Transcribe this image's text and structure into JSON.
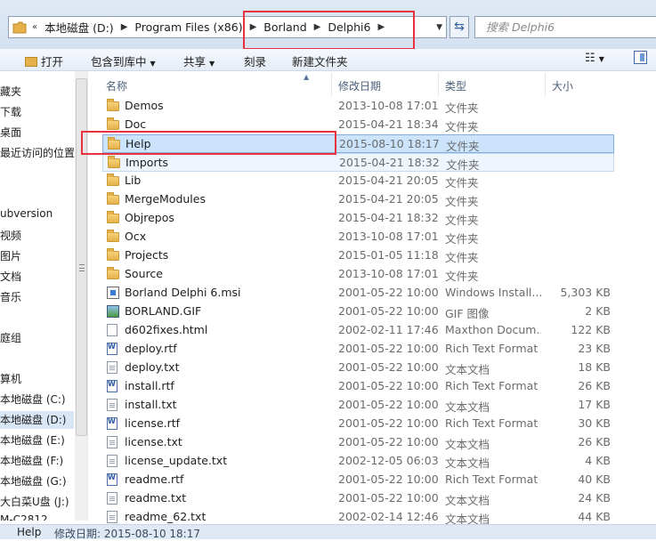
{
  "address": {
    "crumbs": [
      "本地磁盘 (D:)",
      "Program Files (x86)",
      "Borland",
      "Delphi6"
    ],
    "search_placeholder": "搜索 Delphi6"
  },
  "toolbar": {
    "open": "打开",
    "include_in_library": "包含到库中",
    "share": "共享",
    "burn": "刻录",
    "new_folder": "新建文件夹"
  },
  "nav": {
    "items": [
      "藏夹",
      "下载",
      "桌面",
      "最近访问的位置",
      "ubversion",
      "视频",
      "图片",
      "文档",
      "音乐",
      "庭组",
      "算机",
      "本地磁盘 (C:)",
      "本地磁盘 (D:)",
      "本地磁盘 (E:)",
      "本地磁盘 (F:)",
      "本地磁盘 (G:)",
      "大白菜U盘 (J:)",
      "M-C2812"
    ],
    "selected": "本地磁盘 (D:)"
  },
  "columns": {
    "name": "名称",
    "modified": "修改日期",
    "type": "类型",
    "size": "大小"
  },
  "files": [
    {
      "name": "Demos",
      "date": "2013-10-08 17:01",
      "type": "文件夹",
      "size": "",
      "icon": "folder-icon"
    },
    {
      "name": "Doc",
      "date": "2015-04-21 18:34",
      "type": "文件夹",
      "size": "",
      "icon": "folder-icon"
    },
    {
      "name": "Help",
      "date": "2015-08-10 18:17",
      "type": "文件夹",
      "size": "",
      "icon": "folder-icon",
      "selected": true
    },
    {
      "name": "Imports",
      "date": "2015-04-21 18:32",
      "type": "文件夹",
      "size": "",
      "icon": "folder-icon",
      "hover": true
    },
    {
      "name": "Lib",
      "date": "2015-04-21 20:05",
      "type": "文件夹",
      "size": "",
      "icon": "folder-icon"
    },
    {
      "name": "MergeModules",
      "date": "2015-04-21 20:05",
      "type": "文件夹",
      "size": "",
      "icon": "folder-icon"
    },
    {
      "name": "Objrepos",
      "date": "2015-04-21 18:32",
      "type": "文件夹",
      "size": "",
      "icon": "folder-icon"
    },
    {
      "name": "Ocx",
      "date": "2013-10-08 17:01",
      "type": "文件夹",
      "size": "",
      "icon": "folder-icon"
    },
    {
      "name": "Projects",
      "date": "2015-01-05 11:18",
      "type": "文件夹",
      "size": "",
      "icon": "folder-icon"
    },
    {
      "name": "Source",
      "date": "2013-10-08 17:01",
      "type": "文件夹",
      "size": "",
      "icon": "folder-icon"
    },
    {
      "name": "Borland Delphi 6.msi",
      "date": "2001-05-22 10:00",
      "type": "Windows Install...",
      "size": "5,303 KB",
      "icon": "msi-icon"
    },
    {
      "name": "BORLAND.GIF",
      "date": "2001-05-22 10:00",
      "type": "GIF 图像",
      "size": "2 KB",
      "icon": "gif-icon"
    },
    {
      "name": "d602fixes.html",
      "date": "2002-02-11 17:46",
      "type": "Maxthon Docum...",
      "size": "122 KB",
      "icon": "html-icon"
    },
    {
      "name": "deploy.rtf",
      "date": "2001-05-22 10:00",
      "type": "Rich Text Format",
      "size": "23 KB",
      "icon": "rtf-icon"
    },
    {
      "name": "deploy.txt",
      "date": "2001-05-22 10:00",
      "type": "文本文档",
      "size": "18 KB",
      "icon": "txt-icon"
    },
    {
      "name": "install.rtf",
      "date": "2001-05-22 10:00",
      "type": "Rich Text Format",
      "size": "26 KB",
      "icon": "rtf-icon"
    },
    {
      "name": "install.txt",
      "date": "2001-05-22 10:00",
      "type": "文本文档",
      "size": "17 KB",
      "icon": "txt-icon"
    },
    {
      "name": "license.rtf",
      "date": "2001-05-22 10:00",
      "type": "Rich Text Format",
      "size": "30 KB",
      "icon": "rtf-icon"
    },
    {
      "name": "license.txt",
      "date": "2001-05-22 10:00",
      "type": "文本文档",
      "size": "26 KB",
      "icon": "txt-icon"
    },
    {
      "name": "license_update.txt",
      "date": "2002-12-05 06:03",
      "type": "文本文档",
      "size": "4 KB",
      "icon": "txt-icon"
    },
    {
      "name": "readme.rtf",
      "date": "2001-05-22 10:00",
      "type": "Rich Text Format",
      "size": "40 KB",
      "icon": "rtf-icon"
    },
    {
      "name": "readme.txt",
      "date": "2001-05-22 10:00",
      "type": "文本文档",
      "size": "24 KB",
      "icon": "txt-icon"
    },
    {
      "name": "readme_62.txt",
      "date": "2002-02-14 12:46",
      "type": "文本文档",
      "size": "44 KB",
      "icon": "txt-icon"
    }
  ],
  "status": {
    "name": "Help",
    "modified_label": "修改日期: 2015-08-10 18:17"
  },
  "colors": {
    "selection_bg": "#cce4fb",
    "selection_border": "#84acdd",
    "annotation_red": "#e8333f"
  }
}
